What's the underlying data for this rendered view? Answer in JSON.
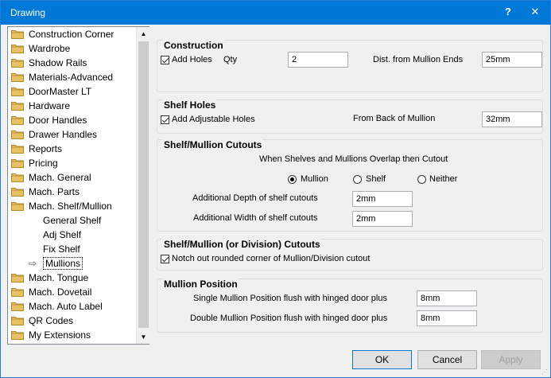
{
  "window": {
    "title": "Drawing",
    "help_label": "?",
    "close_label": "✕"
  },
  "tree": {
    "items": [
      {
        "label": "Construction Corner",
        "type": "folder"
      },
      {
        "label": "Wardrobe",
        "type": "folder"
      },
      {
        "label": "Shadow Rails",
        "type": "folder"
      },
      {
        "label": "Materials-Advanced",
        "type": "folder"
      },
      {
        "label": "DoorMaster LT",
        "type": "folder"
      },
      {
        "label": "Hardware",
        "type": "folder"
      },
      {
        "label": "Door Handles",
        "type": "folder"
      },
      {
        "label": "Drawer Handles",
        "type": "folder"
      },
      {
        "label": "Reports",
        "type": "folder"
      },
      {
        "label": "Pricing",
        "type": "folder"
      },
      {
        "label": "Mach. General",
        "type": "folder"
      },
      {
        "label": "Mach. Parts",
        "type": "folder"
      },
      {
        "label": "Mach. Shelf/Mullion",
        "type": "folder"
      },
      {
        "label": "General Shelf",
        "type": "child"
      },
      {
        "label": "Adj Shelf",
        "type": "child"
      },
      {
        "label": "Fix Shelf",
        "type": "child"
      },
      {
        "label": "Mullions",
        "type": "selected"
      },
      {
        "label": "Mach. Tongue",
        "type": "folder"
      },
      {
        "label": "Mach. Dovetail",
        "type": "folder"
      },
      {
        "label": "Mach. Auto Label",
        "type": "folder"
      },
      {
        "label": "QR Codes",
        "type": "folder"
      },
      {
        "label": "My Extensions",
        "type": "folder"
      }
    ]
  },
  "construction": {
    "title": "Construction",
    "add_holes_label": "Add Holes",
    "add_holes_checked": true,
    "qty_label": "Qty",
    "qty_value": "2",
    "dist_label": "Dist. from Mullion Ends",
    "dist_value": "25mm"
  },
  "shelf_holes": {
    "title": "Shelf Holes",
    "adjustable_label": "Add Adjustable Holes",
    "adjustable_checked": true,
    "from_back_label": "From Back of Mullion",
    "from_back_value": "32mm"
  },
  "shelf_mullion_cutouts": {
    "title": "Shelf/Mullion Cutouts",
    "overlap_label": "When Shelves and Mullions Overlap then Cutout",
    "options": [
      "Mullion",
      "Shelf",
      "Neither"
    ],
    "selected": "Mullion",
    "depth_label": "Additional Depth of shelf cutouts",
    "depth_value": "2mm",
    "width_label": "Additional Width of shelf cutouts",
    "width_value": "2mm"
  },
  "division_cutouts": {
    "title": "Shelf/Mullion (or Division) Cutouts",
    "notch_label": "Notch out rounded corner of Mullion/Division cutout",
    "notch_checked": true
  },
  "mullion_position": {
    "title": "Mullion Position",
    "single_label": "Single Mullion Position flush with hinged door plus",
    "single_value": "8mm",
    "double_label": "Double Mullion Position flush with hinged door plus",
    "double_value": "8mm"
  },
  "buttons": {
    "ok": "OK",
    "cancel": "Cancel",
    "apply": "Apply"
  },
  "colors": {
    "titlebar": "#0078d7",
    "folder": "#e8c060",
    "folder_outline": "#b08a30"
  }
}
